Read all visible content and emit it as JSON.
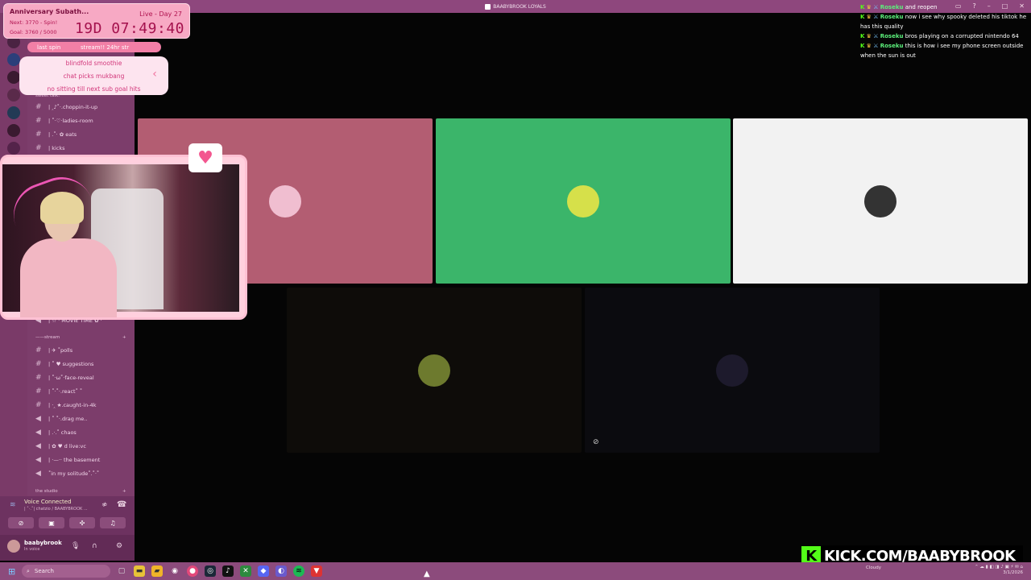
{
  "window": {
    "title": "BAABYBROOK LOYALS"
  },
  "subathon": {
    "title": "Anniversary Subath...",
    "next": "Next: 3770 - Spin!",
    "goal": "Goal: 3760 / 5000",
    "live_day": "Live - Day 27",
    "timer": "19D 07:49:40"
  },
  "spin": {
    "label": "last spin",
    "result": "stream!! 24hr str",
    "items": [
      "blindfold smoothie",
      "chat picks mukbang",
      "no sitting till next sub goal hits"
    ]
  },
  "sidebar": {
    "top_channels": [
      {
        "label": "sweet talk:",
        "kind": "category"
      },
      {
        "label": "| ‸♪˚·.choppin-it-up",
        "kind": "text"
      },
      {
        "label": "| ˚·♡·ladies-room",
        "kind": "text"
      },
      {
        "label": "| .˚· ✿ eats",
        "kind": "text"
      },
      {
        "label": "| kicks",
        "kind": "text"
      }
    ],
    "movie_item": "| ☆ · MOVIE TIME ✿ ·",
    "stream_category": "——stream",
    "stream_channels": [
      {
        "label": "| ✈ ˚polls",
        "kind": "text"
      },
      {
        "label": "| ˚ ♥ suggestions",
        "kind": "text"
      },
      {
        "label": "| ˚·ω˚·face-reveal",
        "kind": "text"
      },
      {
        "label": "| ˚·˚·.react˚ ˚",
        "kind": "text"
      },
      {
        "label": "| ·‸ ★.caught-in-4k",
        "kind": "text"
      },
      {
        "label": "| ˚ ˚·.drag me..",
        "kind": "voice"
      },
      {
        "label": "| .·.˚ chaos",
        "kind": "voice"
      },
      {
        "label": "| ✿ ♥ d live:vc",
        "kind": "voice"
      },
      {
        "label": "| ·—·· the basement",
        "kind": "voice"
      },
      {
        "label": "˚in my solitude˚.˚·˚",
        "kind": "voice"
      }
    ],
    "studio_category": "the studio"
  },
  "voice": {
    "status": "Voice Connected",
    "channel": "| ˚·.˚| chatzio / BAABYBROOK ..."
  },
  "user": {
    "name": "baabybrook",
    "status": "In voice"
  },
  "tiles": [
    {
      "bg": "#b35d72",
      "avatar": "#f0bed0"
    },
    {
      "bg": "#3bb56a",
      "avatar": "#d6e04a"
    },
    {
      "bg": "#f2f2f2",
      "avatar": "#333333"
    },
    {
      "bg": "#0e0c09",
      "avatar": "#6d7a2e"
    },
    {
      "bg": "#0b0b0f",
      "avatar": "#1d1a2c"
    }
  ],
  "chat": [
    {
      "user": "Roseku",
      "text": "and reopen"
    },
    {
      "user": "Roseku",
      "text": "now i see why spooky deleted his tiktok he has this quality"
    },
    {
      "user": "Roseku",
      "text": "bros playing on a corrupted nintendo 64"
    },
    {
      "user": "Roseku",
      "text": "this is how i see my phone screen outside when the sun is out"
    }
  ],
  "kick": {
    "badge": "K",
    "text": "KICK.COM/BAABYBROOK"
  },
  "taskbar": {
    "search_placeholder": "Search",
    "weather": "Cloudy",
    "date": "3/1/2026"
  },
  "colors": {
    "accent": "#53fc18",
    "sidebar": "#7c3d6b",
    "titlebar": "#8e477d",
    "pink": "#f7a9c4"
  }
}
